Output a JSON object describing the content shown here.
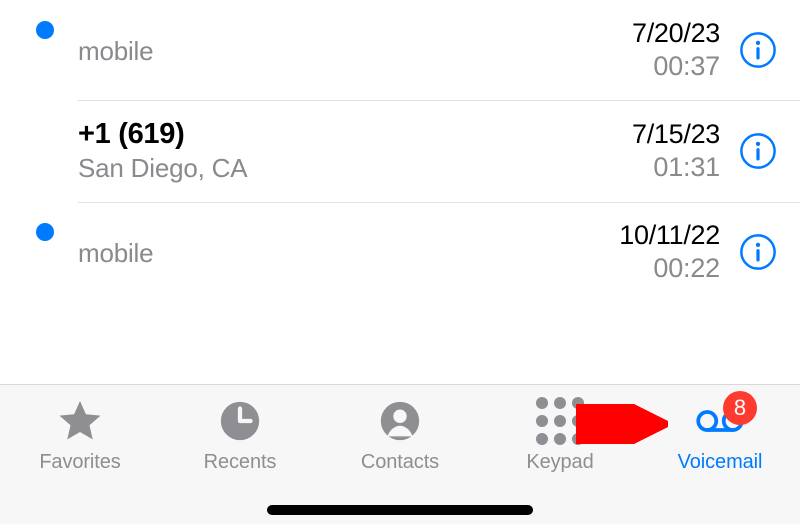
{
  "voicemails": [
    {
      "unread": true,
      "name": "",
      "meta": "mobile",
      "date": "7/20/23",
      "duration": "00:37"
    },
    {
      "unread": false,
      "name": "+1 (619)",
      "meta": "San Diego, CA",
      "date": "7/15/23",
      "duration": "01:31"
    },
    {
      "unread": true,
      "name": "",
      "meta": "mobile",
      "date": "10/11/22",
      "duration": "00:22"
    }
  ],
  "tabs": {
    "favorites": "Favorites",
    "recents": "Recents",
    "contacts": "Contacts",
    "keypad": "Keypad",
    "voicemail": "Voicemail",
    "badge": "8"
  }
}
